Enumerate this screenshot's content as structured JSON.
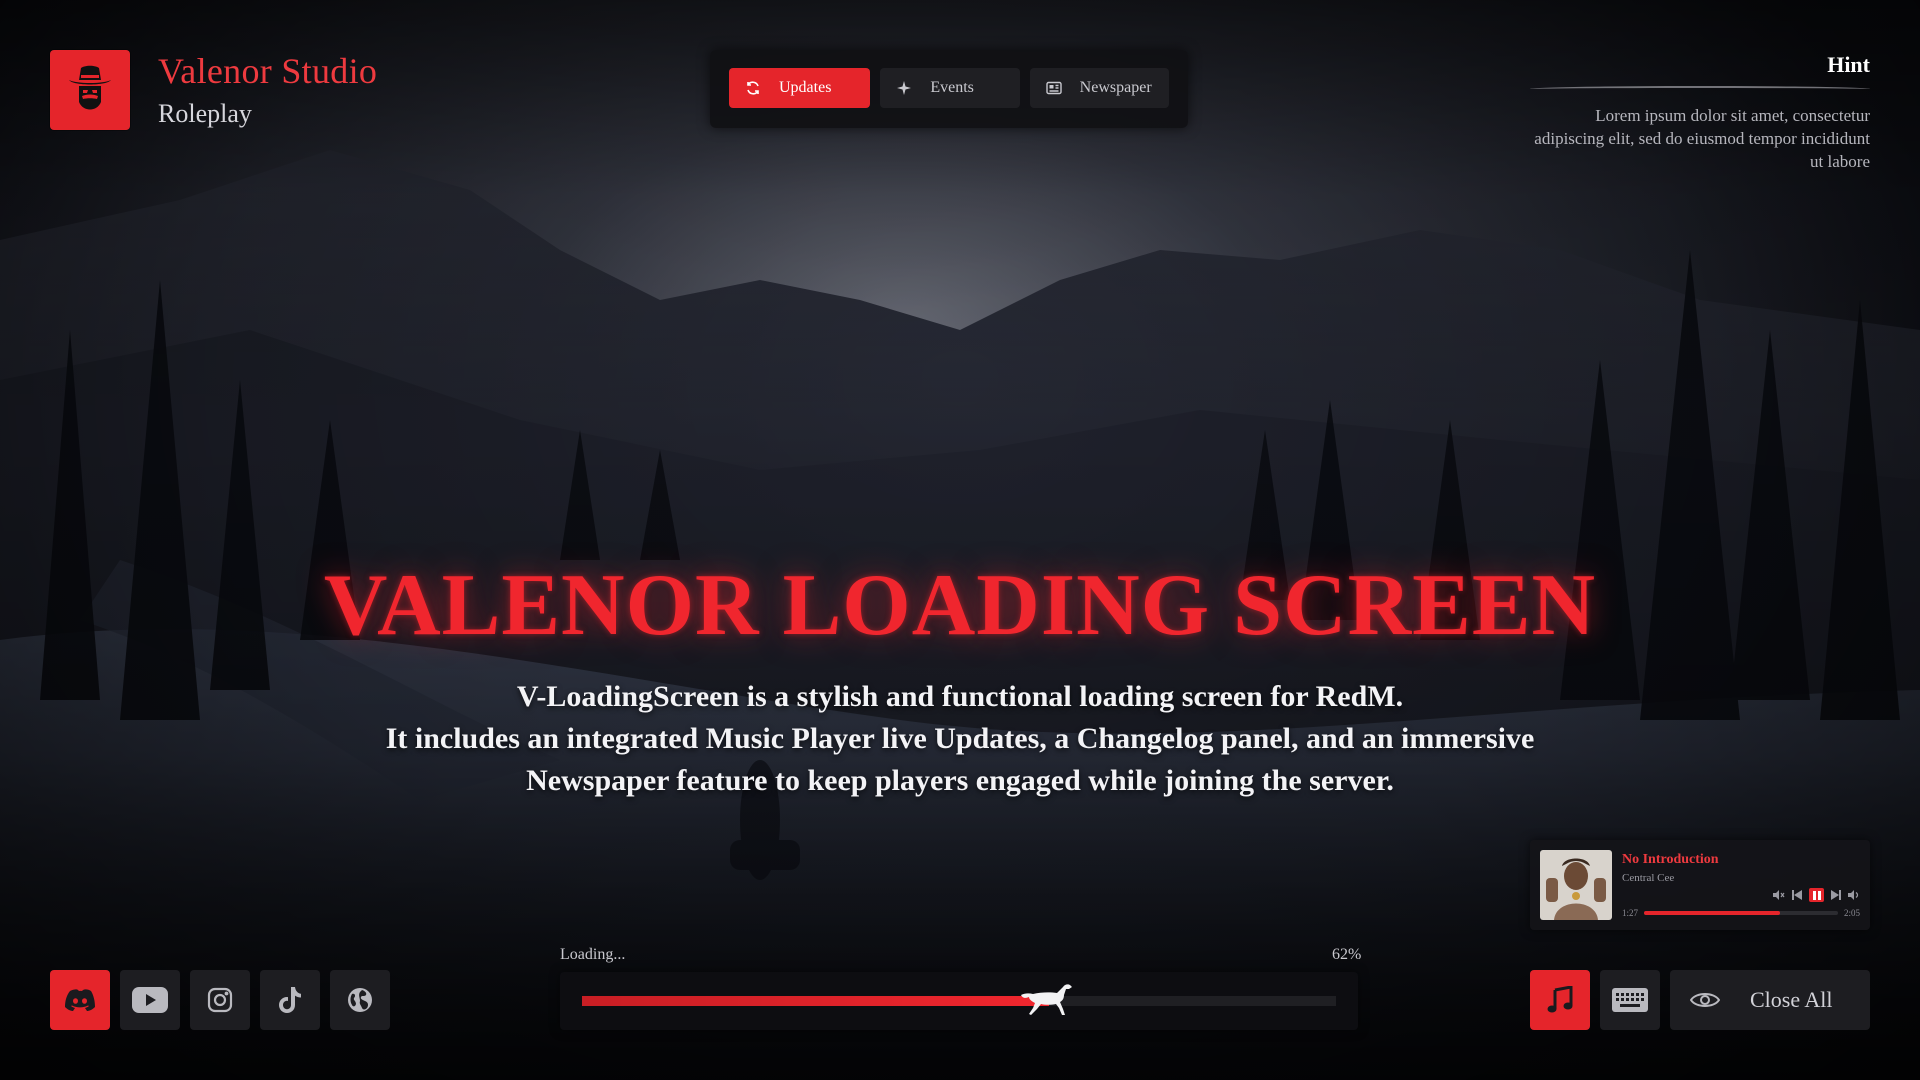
{
  "brand": {
    "name": "Valenor Studio",
    "subtitle": "Roleplay"
  },
  "nav": {
    "tabs": [
      {
        "label": "Updates",
        "icon": "refresh-icon",
        "active": true
      },
      {
        "label": "Events",
        "icon": "sparkle-icon",
        "active": false
      },
      {
        "label": "Newspaper",
        "icon": "newspaper-icon",
        "active": false
      }
    ]
  },
  "hint": {
    "title": "Hint",
    "text": "Lorem ipsum dolor sit amet, consectetur adipiscing elit, sed do eiusmod tempor incididunt ut labore"
  },
  "hero": {
    "title": "VALENOR LOADING SCREEN",
    "lines": [
      "V-LoadingScreen is a stylish and functional loading screen for RedM.",
      "It includes an integrated Music Player live Updates, a Changelog panel, and an immersive",
      "Newspaper feature to keep players engaged while joining the server."
    ]
  },
  "player": {
    "song": "No Introduction",
    "artist": "Central Cee",
    "elapsed": "1:27",
    "duration": "2:05",
    "progress": 0.7,
    "state": "playing"
  },
  "loading": {
    "label": "Loading...",
    "percent_text": "62%",
    "progress": 0.62
  },
  "socials": [
    "discord-icon",
    "youtube-icon",
    "instagram-icon",
    "tiktok-icon",
    "globe-icon"
  ],
  "bottom_right": {
    "close_all_label": "Close All"
  },
  "colors": {
    "accent": "#e5252b",
    "panel": "#1d1d21",
    "background": "#0d0f16"
  }
}
